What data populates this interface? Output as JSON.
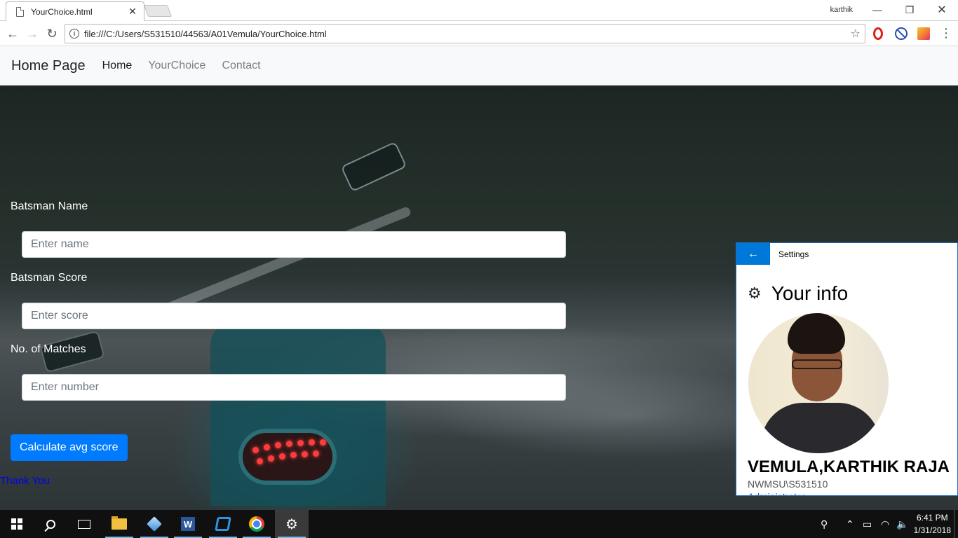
{
  "browser": {
    "tab_title": "YourChoice.html",
    "tab_close": "✕",
    "profile_name": "karthik",
    "url": "file:///C:/Users/S531510/44563/A01Vemula/YourChoice.html",
    "icons": [
      "back-arrow-icon",
      "forward-arrow-icon",
      "reload-icon",
      "info-icon",
      "star-icon",
      "opera-icon",
      "adblock-icon",
      "photos-extension-icon",
      "menu-dots-icon"
    ]
  },
  "site_nav": {
    "brand": "Home Page",
    "links": [
      {
        "label": "Home",
        "active": true
      },
      {
        "label": "YourChoice",
        "active": false
      },
      {
        "label": "Contact",
        "active": false
      }
    ]
  },
  "form": {
    "name_label": "Batsman Name",
    "name_placeholder": "Enter name",
    "score_label": "Batsman Score",
    "score_placeholder": "Enter score",
    "matches_label": "No. of Matches",
    "matches_placeholder": "Enter number",
    "submit_label": "Calculate avg score",
    "thank_you": "Thank You"
  },
  "settings": {
    "window_title": "Settings",
    "heading": "Your info",
    "user_name": "VEMULA,KARTHIK RAJA",
    "domain": "NWMSU\\S531510",
    "role": "Administrator",
    "accent": "#0078d7"
  },
  "taskbar": {
    "time": "6:41 PM",
    "date": "1/31/2018",
    "apps": [
      "start-icon",
      "search-icon",
      "task-view-icon",
      "file-explorer-icon",
      "3d-builder-icon",
      "word-icon",
      "vscode-icon",
      "chrome-icon",
      "settings-icon"
    ]
  },
  "colors": {
    "primary_button": "#007bff",
    "link": "#0000ee",
    "navbar_bg": "#f8f9fa"
  }
}
